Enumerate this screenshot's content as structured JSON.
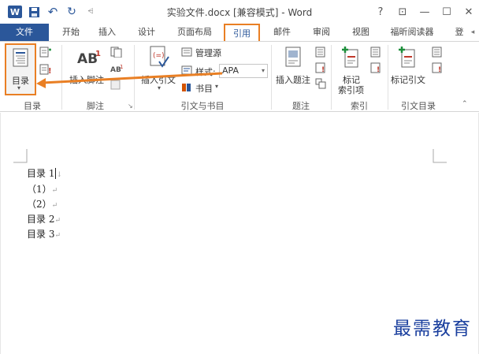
{
  "window": {
    "title": "实验文件.docx [兼容模式] - Word",
    "help": "?",
    "restore_ribbon": "⊡",
    "minimize": "—",
    "maximize": "☐",
    "close": "✕"
  },
  "qat": {
    "app_logo": "W",
    "undo": "↶",
    "redo": "↻",
    "customize": "⩤"
  },
  "tabs": [
    {
      "label": "文件"
    },
    {
      "label": "开始"
    },
    {
      "label": "插入"
    },
    {
      "label": "设计"
    },
    {
      "label": "页面布局"
    },
    {
      "label": "引用"
    },
    {
      "label": "邮件"
    },
    {
      "label": "审阅"
    },
    {
      "label": "视图"
    },
    {
      "label": "福昕阅读器"
    },
    {
      "label": "登"
    }
  ],
  "ribbon": {
    "toc": {
      "button_label": "目录",
      "group_label": "目录"
    },
    "footnotes": {
      "insert_footnote_label": "插入脚注",
      "ab_icon_text": "AB",
      "ab_sup": "1",
      "group_label": "脚注"
    },
    "citations": {
      "insert_citation_label": "插入引文",
      "manage_sources_label": "管理源",
      "style_label": "样式:",
      "style_value": "APA",
      "bibliography_label": "书目",
      "group_label": "引文与书目"
    },
    "captions": {
      "insert_caption_label": "插入题注",
      "group_label": "题注"
    },
    "index": {
      "mark_entry_label_1": "标记",
      "mark_entry_label_2": "索引项",
      "group_label": "索引"
    },
    "toa": {
      "mark_citation_label": "标记引文",
      "group_label": "引文目录"
    }
  },
  "document": {
    "lines": [
      {
        "text": "目录 1",
        "mark": "↓"
      },
      {
        "text": "（1）",
        "mark": "↵"
      },
      {
        "text": "（2）",
        "mark": "↵"
      },
      {
        "text": "目录 2",
        "mark": "↵"
      },
      {
        "text": "目录 3",
        "mark": "↵"
      }
    ]
  },
  "watermark": "最需教育",
  "colors": {
    "brand": "#2b579a",
    "highlight": "#e97f24"
  }
}
